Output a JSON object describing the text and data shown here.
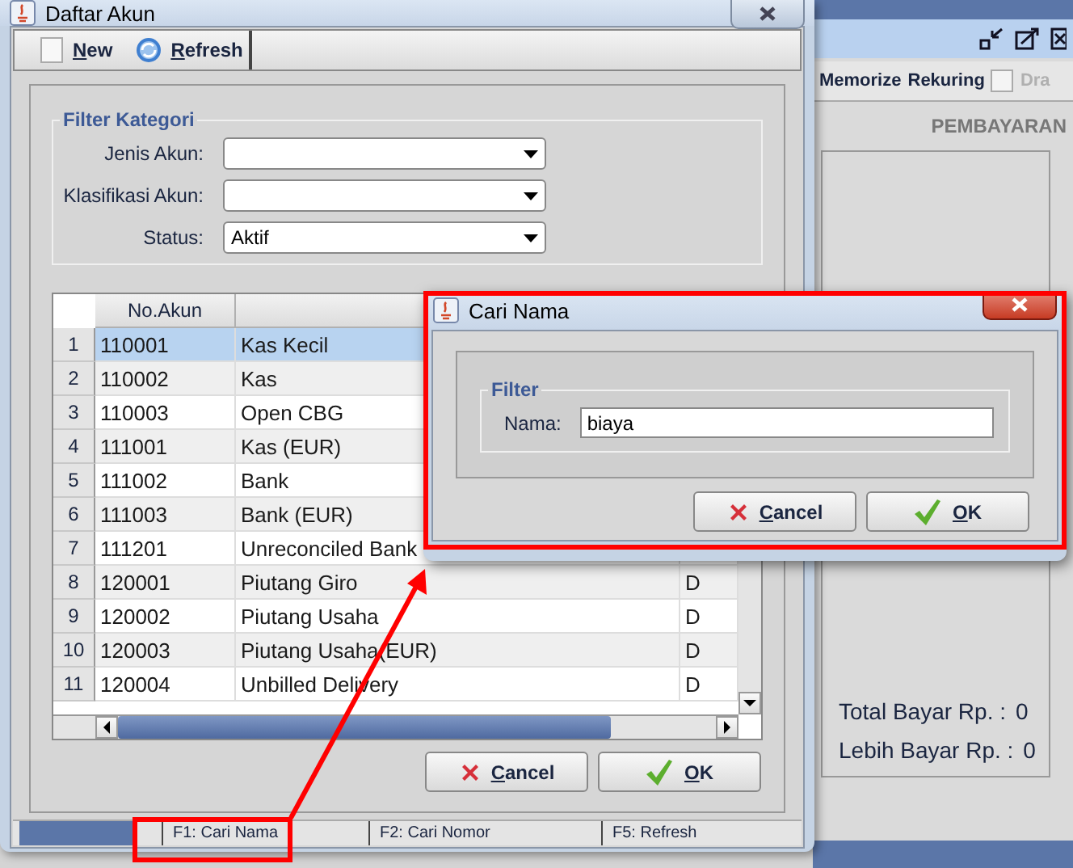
{
  "back_window": {
    "toolbar": [
      {
        "label": "Memorize"
      },
      {
        "label": "Rekuring"
      }
    ],
    "draft_checkbox": {
      "label": "Dra",
      "checked": false,
      "disabled": true
    },
    "heading": "PEMBAYARAN",
    "totals": [
      {
        "label": "Total Bayar Rp. :",
        "value": "0"
      },
      {
        "label": "Lebih Bayar Rp. :",
        "value": "0"
      }
    ]
  },
  "main_window": {
    "title": "Daftar Akun",
    "toolbar": [
      {
        "label": "New",
        "kind": "new"
      },
      {
        "label": "Refresh",
        "kind": "refresh"
      }
    ],
    "filter": {
      "title": "Filter Kategori",
      "fields": [
        {
          "label": "Jenis Akun:"
        },
        {
          "label": "Klasifikasi Akun:"
        },
        {
          "label": "Status:",
          "value": "Aktif"
        }
      ]
    },
    "table": {
      "columns": [
        "No.Akun"
      ],
      "rows": [
        {
          "number": "1",
          "account": "110001",
          "name": "Kas Kecil",
          "selected": true
        },
        {
          "number": "2",
          "account": "110002",
          "name": "Kas",
          "selected": false
        },
        {
          "number": "3",
          "account": "110003",
          "name": "Open CBG",
          "selected": false
        },
        {
          "number": "4",
          "account": "111001",
          "name": "Kas (EUR)",
          "selected": false
        },
        {
          "number": "5",
          "account": "111002",
          "name": "Bank",
          "selected": false
        },
        {
          "number": "6",
          "account": "111003",
          "name": "Bank (EUR)",
          "selected": false
        },
        {
          "number": "7",
          "account": "111201",
          "name": "Unreconciled Bank",
          "selected": false
        },
        {
          "number": "8",
          "account": "120001",
          "name": "Piutang Giro",
          "column_3": "D",
          "selected": false
        },
        {
          "number": "9",
          "account": "120002",
          "name": "Piutang Usaha",
          "column_3": "D",
          "selected": false
        },
        {
          "number": "10",
          "account": "120003",
          "name": "Piutang Usaha(EUR)",
          "column_3": "D",
          "selected": false
        },
        {
          "number": "11",
          "account": "120004",
          "name": "Unbilled Delivery",
          "column_3": "D",
          "selected": false
        }
      ]
    },
    "buttons": [
      {
        "label": "Cancel",
        "kind": "cancel"
      },
      {
        "label": "OK",
        "kind": "ok"
      }
    ],
    "status_bar": [
      "F1: Cari Nama",
      "F2: Cari Nomor",
      "F5: Refresh"
    ]
  },
  "dialog": {
    "title": "Cari Nama",
    "group": "Filter",
    "field": {
      "label": "Nama:",
      "value": "biaya"
    },
    "buttons": [
      {
        "label": "Cancel",
        "kind": "cancel"
      },
      {
        "label": "OK",
        "kind": "ok"
      }
    ]
  }
}
